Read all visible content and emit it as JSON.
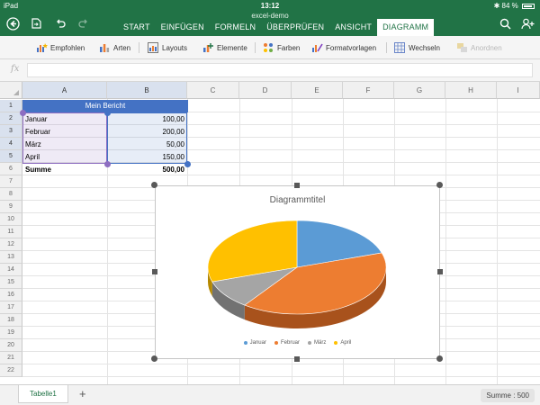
{
  "status_bar": {
    "device": "iPad",
    "time": "13:12",
    "battery": "84 %"
  },
  "document_name": "excel-demo",
  "ribbon_tabs": [
    {
      "label": "START"
    },
    {
      "label": "EINFÜGEN"
    },
    {
      "label": "FORMELN"
    },
    {
      "label": "ÜBERPRÜFEN"
    },
    {
      "label": "ANSICHT"
    },
    {
      "label": "DIAGRAMM"
    }
  ],
  "active_tab": "DIAGRAMM",
  "ribbon": {
    "empfohlen": "Empfohlen",
    "arten": "Arten",
    "layouts": "Layouts",
    "elemente": "Elemente",
    "farben": "Farben",
    "formatvorlagen": "Formatvorlagen",
    "wechseln": "Wechseln",
    "anordnen": "Anordnen"
  },
  "formula_bar": {
    "fx_label": "fx",
    "value": ""
  },
  "columns": [
    "A",
    "B",
    "C",
    "D",
    "E",
    "F",
    "G",
    "H",
    "I"
  ],
  "rows": [
    "1",
    "2",
    "3",
    "4",
    "5",
    "6",
    "7",
    "8",
    "9",
    "10",
    "11",
    "12",
    "13",
    "14",
    "15",
    "16",
    "17",
    "18",
    "19",
    "20",
    "21",
    "22"
  ],
  "sheet": {
    "title": "Mein Bericht",
    "data_rows": [
      {
        "label": "Januar",
        "value": "100,00"
      },
      {
        "label": "Februar",
        "value": "200,00"
      },
      {
        "label": "März",
        "value": "50,00"
      },
      {
        "label": "April",
        "value": "150,00"
      }
    ],
    "total_label": "Summe",
    "total_value": "500,00"
  },
  "chart_data": {
    "type": "pie",
    "title": "Diagrammtitel",
    "categories": [
      "Januar",
      "Februar",
      "März",
      "April"
    ],
    "values": [
      100,
      200,
      50,
      150
    ],
    "colors": [
      "#5b9bd5",
      "#ed7d31",
      "#a5a5a5",
      "#ffc000"
    ],
    "side_colors": [
      "#3c6e9e",
      "#a8521c",
      "#727272",
      "#b68900"
    ],
    "style": "3d",
    "legend_position": "bottom"
  },
  "bottom_bar": {
    "sheet_tab": "Tabelle1",
    "add_sheet": "+",
    "sum_label": "Summe : 500"
  }
}
